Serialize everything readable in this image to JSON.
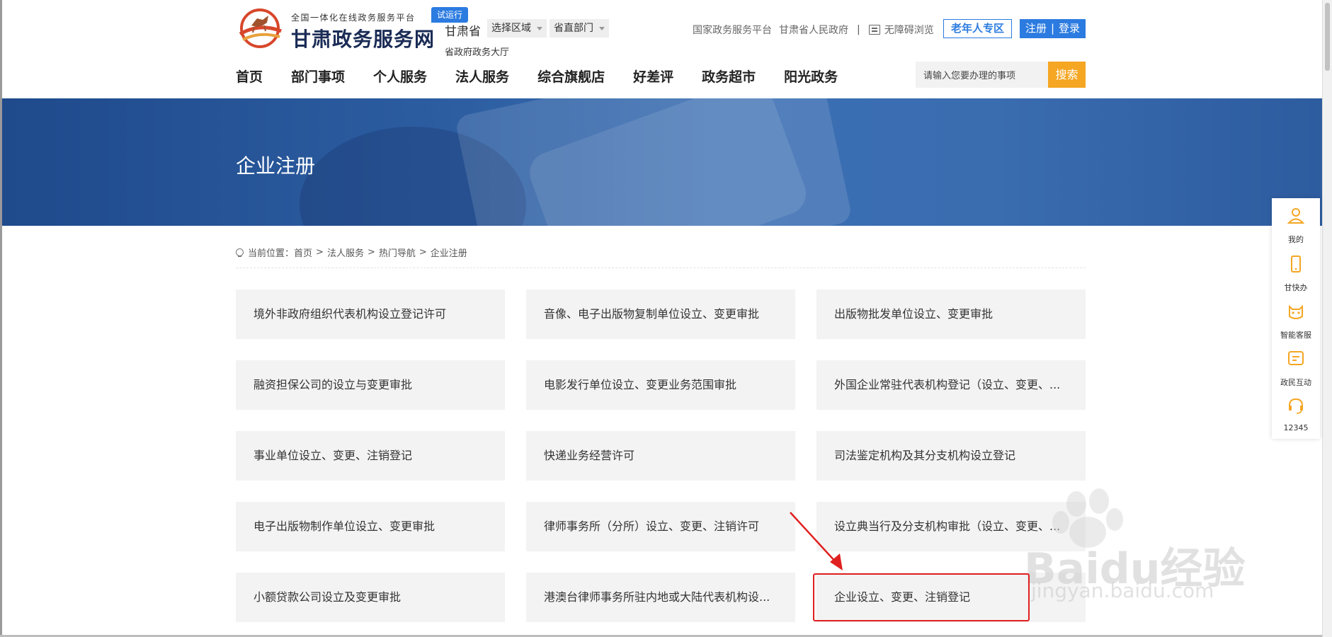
{
  "header": {
    "logo_subtitle": "全国一体化在线政务服务平台",
    "logo_title": "甘肃政务服务网",
    "trial_badge": "试运行",
    "province": "甘肃省",
    "region_select": "选择区域",
    "dept_select": "省直部门",
    "hall_label": "省政府政务大厅",
    "top_links": {
      "national_platform": "国家政务服务平台",
      "gov_site": "甘肃省人民政府",
      "separator": "|",
      "accessible": "无障碍浏览"
    },
    "elder_zone": "老年人专区",
    "register": "注册",
    "login_sep": "|",
    "login": "登录"
  },
  "nav": {
    "items": [
      "首页",
      "部门事项",
      "个人服务",
      "法人服务",
      "综合旗舰店",
      "好差评",
      "政务超市",
      "阳光政务"
    ]
  },
  "search": {
    "placeholder": "请输入您要办理的事项",
    "button": "搜索"
  },
  "banner": {
    "title": "企业注册"
  },
  "breadcrumb": {
    "prefix": "当前位置：",
    "items": [
      "首页",
      "法人服务",
      "热门导航",
      "企业注册"
    ],
    "separator": ">"
  },
  "services": [
    "境外非政府组织代表机构设立登记许可",
    "音像、电子出版物复制单位设立、变更审批",
    "出版物批发单位设立、变更审批",
    "融资担保公司的设立与变更审批",
    "电影发行单位设立、变更业务范围审批",
    "外国企业常驻代表机构登记（设立、变更、...",
    "事业单位设立、变更、注销登记",
    "快递业务经营许可",
    "司法鉴定机构及其分支机构设立登记",
    "电子出版物制作单位设立、变更审批",
    "律师事务所（分所）设立、变更、注销许可",
    "设立典当行及分支机构审批（设立、变更、...",
    "小额贷款公司设立及变更审批",
    "港澳台律师事务所驻内地或大陆代表机构设...",
    "企业设立、变更、注销登记"
  ],
  "sidebar": {
    "items": [
      {
        "label": "我的",
        "icon": "user-icon"
      },
      {
        "label": "甘快办",
        "icon": "phone-icon"
      },
      {
        "label": "智能客服",
        "icon": "robot-icon"
      },
      {
        "label": "政民互动",
        "icon": "chat-icon"
      },
      {
        "label": "12345",
        "icon": "headset-icon"
      }
    ]
  },
  "watermark": {
    "brand": "Bai",
    "brand2": "du",
    "suffix": "经验",
    "url": "jingyan.baidu.com"
  },
  "colors": {
    "primary_blue": "#2b7be0",
    "search_orange": "#f5a623",
    "sidebar_orange": "#f5a623",
    "highlight_red": "#e02020"
  }
}
